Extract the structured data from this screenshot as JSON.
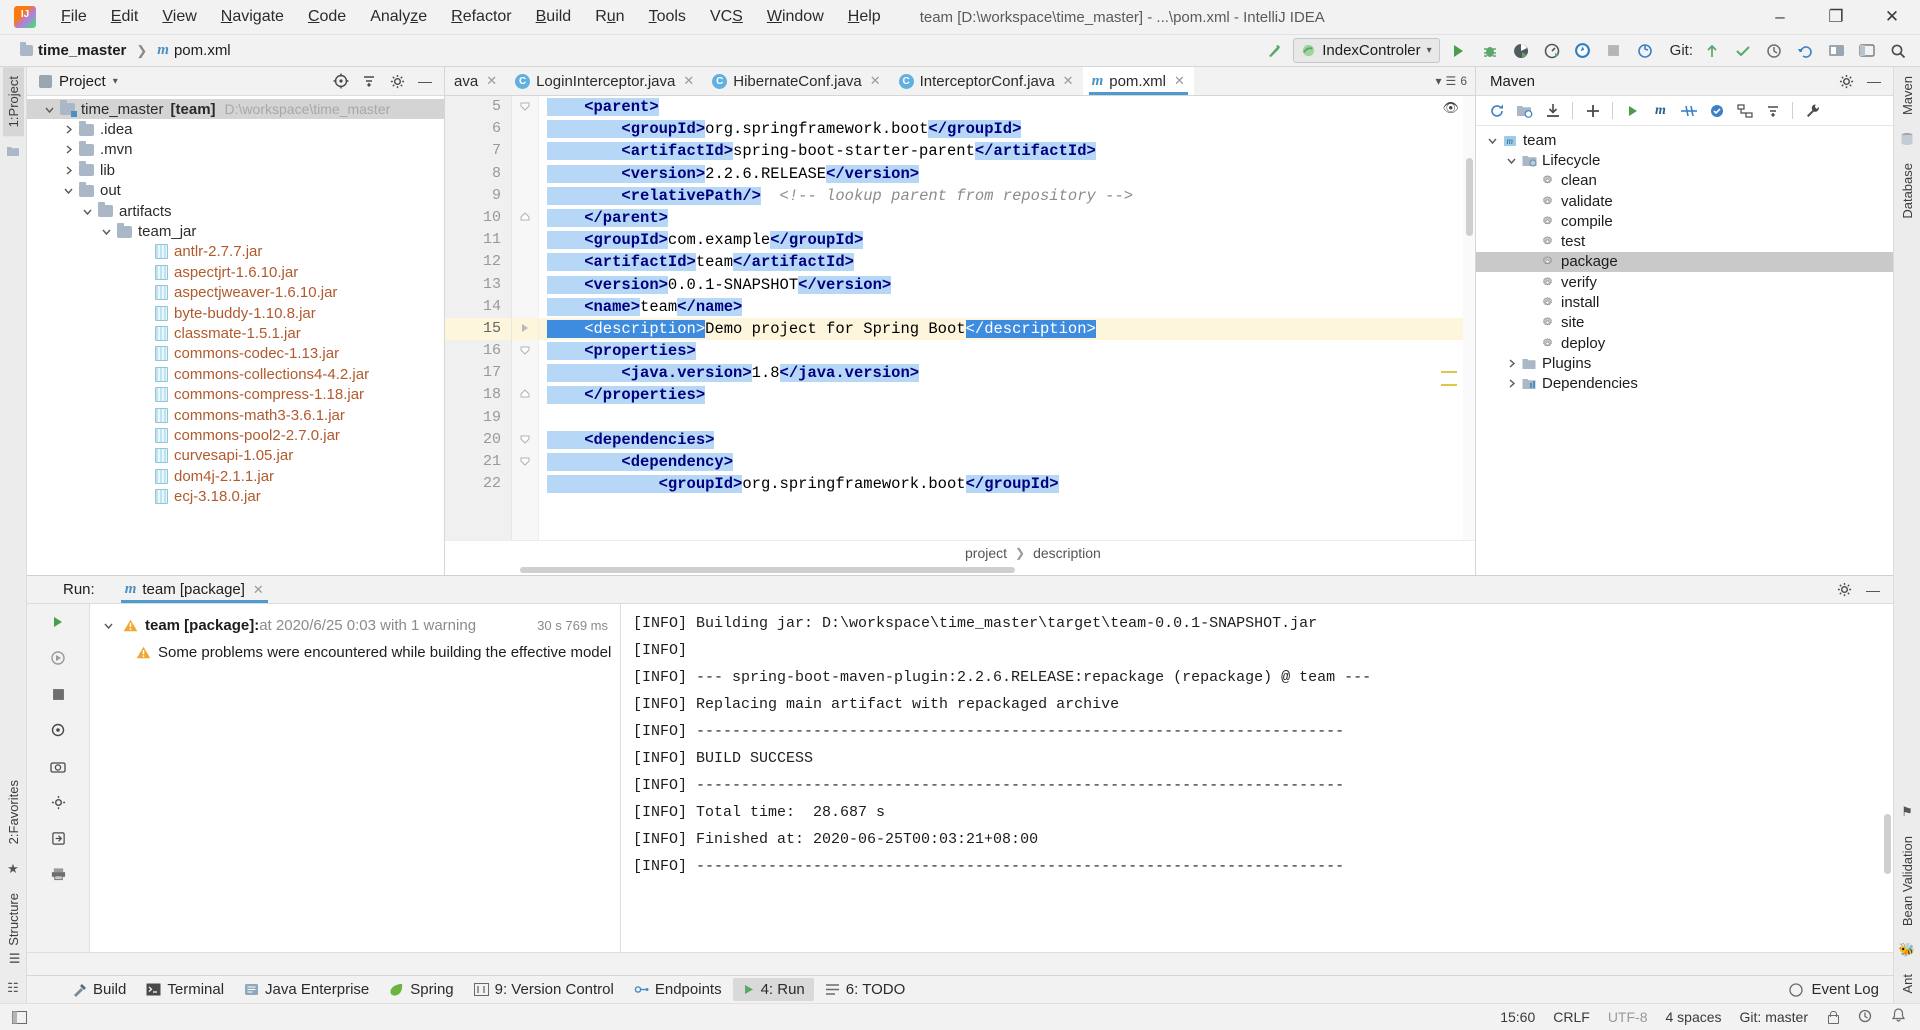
{
  "window": {
    "title": "team [D:\\workspace\\time_master] - ...\\pom.xml - IntelliJ IDEA",
    "minimize": "–",
    "maximize": "❐",
    "close": "✕"
  },
  "menu": [
    "File",
    "Edit",
    "View",
    "Navigate",
    "Code",
    "Analyze",
    "Refactor",
    "Build",
    "Run",
    "Tools",
    "VCS",
    "Window",
    "Help"
  ],
  "navbar": {
    "crumb_project": "time_master",
    "crumb_file": "pom.xml",
    "run_config": "IndexControler",
    "git_label": "Git:",
    "icons": [
      "build-icon",
      "run-icon",
      "debug-icon",
      "run-coverage-icon",
      "profiler-icon",
      "browser-icon",
      "stop-icon",
      "search-everywhere-icon"
    ]
  },
  "left_strip": {
    "tabs": [
      "Project",
      "Favorites",
      "Structure"
    ],
    "numbers": [
      "1:",
      "2:",
      ""
    ]
  },
  "right_strip": {
    "tabs": [
      "Maven",
      "Database",
      "Bean Validation",
      "Ant"
    ]
  },
  "project_panel": {
    "title": "Project",
    "tree": [
      {
        "depth": 0,
        "arrow": "down",
        "icon": "folder-module",
        "label": "time_master",
        "bracket": "[team]",
        "path": "D:\\workspace\\time_master",
        "selected": true
      },
      {
        "depth": 1,
        "arrow": "right",
        "icon": "folder",
        "label": ".idea"
      },
      {
        "depth": 1,
        "arrow": "right",
        "icon": "folder",
        "label": ".mvn"
      },
      {
        "depth": 1,
        "arrow": "right",
        "icon": "folder",
        "label": "lib"
      },
      {
        "depth": 1,
        "arrow": "down",
        "icon": "folder",
        "label": "out"
      },
      {
        "depth": 2,
        "arrow": "down",
        "icon": "folder",
        "label": "artifacts"
      },
      {
        "depth": 3,
        "arrow": "down",
        "icon": "folder",
        "label": "team_jar"
      },
      {
        "depth": 5,
        "arrow": "none",
        "icon": "jar",
        "label": "antlr-2.7.7.jar"
      },
      {
        "depth": 5,
        "arrow": "none",
        "icon": "jar",
        "label": "aspectjrt-1.6.10.jar"
      },
      {
        "depth": 5,
        "arrow": "none",
        "icon": "jar",
        "label": "aspectjweaver-1.6.10.jar"
      },
      {
        "depth": 5,
        "arrow": "none",
        "icon": "jar",
        "label": "byte-buddy-1.10.8.jar"
      },
      {
        "depth": 5,
        "arrow": "none",
        "icon": "jar",
        "label": "classmate-1.5.1.jar"
      },
      {
        "depth": 5,
        "arrow": "none",
        "icon": "jar",
        "label": "commons-codec-1.13.jar"
      },
      {
        "depth": 5,
        "arrow": "none",
        "icon": "jar",
        "label": "commons-collections4-4.2.jar"
      },
      {
        "depth": 5,
        "arrow": "none",
        "icon": "jar",
        "label": "commons-compress-1.18.jar"
      },
      {
        "depth": 5,
        "arrow": "none",
        "icon": "jar",
        "label": "commons-math3-3.6.1.jar"
      },
      {
        "depth": 5,
        "arrow": "none",
        "icon": "jar",
        "label": "commons-pool2-2.7.0.jar"
      },
      {
        "depth": 5,
        "arrow": "none",
        "icon": "jar",
        "label": "curvesapi-1.05.jar"
      },
      {
        "depth": 5,
        "arrow": "none",
        "icon": "jar",
        "label": "dom4j-2.1.1.jar"
      },
      {
        "depth": 5,
        "arrow": "none",
        "icon": "jar",
        "label": "ecj-3.18.0.jar"
      }
    ]
  },
  "editor": {
    "tabs": [
      {
        "label": "ava",
        "icon": "none",
        "active": false,
        "clipped": true
      },
      {
        "label": "LoginInterceptor.java",
        "icon": "class",
        "active": false
      },
      {
        "label": "HibernateConf.java",
        "icon": "class",
        "active": false
      },
      {
        "label": "InterceptorConf.java",
        "icon": "class",
        "active": false
      },
      {
        "label": "pom.xml",
        "icon": "maven",
        "active": true
      }
    ],
    "tab_overflow": "6",
    "lines": [
      {
        "n": "5",
        "fold": "down",
        "segs": [
          {
            "t": "tag",
            "s": "    <parent>"
          }
        ]
      },
      {
        "n": "6",
        "fold": "",
        "segs": [
          {
            "t": "tag",
            "s": "        <groupId>"
          },
          {
            "t": "txt",
            "s": "org.springframework.boot"
          },
          {
            "t": "tag",
            "s": "</groupId>"
          }
        ]
      },
      {
        "n": "7",
        "fold": "",
        "segs": [
          {
            "t": "tag",
            "s": "        <artifactId>"
          },
          {
            "t": "txt",
            "s": "spring-boot-starter-parent"
          },
          {
            "t": "tag",
            "s": "</artifactId>"
          }
        ]
      },
      {
        "n": "8",
        "fold": "",
        "segs": [
          {
            "t": "tag",
            "s": "        <version>"
          },
          {
            "t": "txt",
            "s": "2.2.6.RELEASE"
          },
          {
            "t": "tag",
            "s": "</version>"
          }
        ]
      },
      {
        "n": "9",
        "fold": "",
        "segs": [
          {
            "t": "tag",
            "s": "        <relativePath/>"
          },
          {
            "t": "cmt",
            "s": "  <!-- lookup parent from repository -->"
          }
        ]
      },
      {
        "n": "10",
        "fold": "up",
        "segs": [
          {
            "t": "tag",
            "s": "    </parent>"
          }
        ]
      },
      {
        "n": "11",
        "fold": "",
        "segs": [
          {
            "t": "tag",
            "s": "    <groupId>"
          },
          {
            "t": "txt",
            "s": "com.example"
          },
          {
            "t": "tag",
            "s": "</groupId>"
          }
        ]
      },
      {
        "n": "12",
        "fold": "",
        "segs": [
          {
            "t": "tag",
            "s": "    <artifactId>"
          },
          {
            "t": "txt",
            "s": "team"
          },
          {
            "t": "tag",
            "s": "</artifactId>"
          }
        ]
      },
      {
        "n": "13",
        "fold": "",
        "segs": [
          {
            "t": "tag",
            "s": "    <version>"
          },
          {
            "t": "txt",
            "s": "0.0.1-SNAPSHOT"
          },
          {
            "t": "tag",
            "s": "</version>"
          }
        ]
      },
      {
        "n": "14",
        "fold": "",
        "segs": [
          {
            "t": "tag",
            "s": "    <name>"
          },
          {
            "t": "txt",
            "s": "team"
          },
          {
            "t": "tag",
            "s": "</name>"
          }
        ]
      },
      {
        "n": "15",
        "fold": "",
        "highlight": true,
        "segs": [
          {
            "t": "sel",
            "s": "    <description>"
          },
          {
            "t": "txt",
            "s": "Demo project for Spring Boot"
          },
          {
            "t": "sel",
            "s": "</description>"
          }
        ]
      },
      {
        "n": "16",
        "fold": "down",
        "segs": [
          {
            "t": "tag",
            "s": "    <properties>"
          }
        ]
      },
      {
        "n": "17",
        "fold": "",
        "segs": [
          {
            "t": "tag",
            "s": "        <java.version>"
          },
          {
            "t": "txt",
            "s": "1.8"
          },
          {
            "t": "tag",
            "s": "</java.version>"
          }
        ]
      },
      {
        "n": "18",
        "fold": "up",
        "segs": [
          {
            "t": "tag",
            "s": "    </properties>"
          }
        ]
      },
      {
        "n": "19",
        "fold": "",
        "segs": [
          {
            "t": "txt",
            "s": ""
          }
        ]
      },
      {
        "n": "20",
        "fold": "down",
        "segs": [
          {
            "t": "tag",
            "s": "    <dependencies>"
          }
        ]
      },
      {
        "n": "21",
        "fold": "down",
        "segs": [
          {
            "t": "tag",
            "s": "        <dependency>"
          }
        ]
      },
      {
        "n": "22",
        "fold": "",
        "segs": [
          {
            "t": "tag",
            "s": "            <groupId>"
          },
          {
            "t": "txt",
            "s": "org.springframework.boot"
          },
          {
            "t": "tag",
            "s": "</groupId>"
          }
        ]
      }
    ],
    "breadcrumb": [
      "project",
      "description"
    ]
  },
  "maven_panel": {
    "title": "Maven",
    "toolbar_icons": [
      "reimport-icon",
      "generate-sources-icon",
      "download-sources-icon",
      "add-icon",
      "run-icon",
      "maven-m-icon",
      "skip-tests-icon",
      "toggle-offline-icon",
      "show-diagram-icon",
      "collapse-all-icon",
      "settings-icon"
    ],
    "tree": [
      {
        "depth": 0,
        "arrow": "down",
        "icon": "maven-project",
        "label": "team"
      },
      {
        "depth": 1,
        "arrow": "down",
        "icon": "lifecycle",
        "label": "Lifecycle"
      },
      {
        "depth": 2,
        "arrow": "none",
        "icon": "gear",
        "label": "clean"
      },
      {
        "depth": 2,
        "arrow": "none",
        "icon": "gear",
        "label": "validate"
      },
      {
        "depth": 2,
        "arrow": "none",
        "icon": "gear",
        "label": "compile"
      },
      {
        "depth": 2,
        "arrow": "none",
        "icon": "gear",
        "label": "test"
      },
      {
        "depth": 2,
        "arrow": "none",
        "icon": "gear",
        "label": "package",
        "selected": true
      },
      {
        "depth": 2,
        "arrow": "none",
        "icon": "gear",
        "label": "verify"
      },
      {
        "depth": 2,
        "arrow": "none",
        "icon": "gear",
        "label": "install"
      },
      {
        "depth": 2,
        "arrow": "none",
        "icon": "gear",
        "label": "site"
      },
      {
        "depth": 2,
        "arrow": "none",
        "icon": "gear",
        "label": "deploy"
      },
      {
        "depth": 1,
        "arrow": "right",
        "icon": "plugins",
        "label": "Plugins"
      },
      {
        "depth": 1,
        "arrow": "right",
        "icon": "dependencies",
        "label": "Dependencies"
      }
    ]
  },
  "run_panel": {
    "label": "Run:",
    "tab": "team [package]",
    "tree": [
      {
        "bold": "team [package]:",
        "text": " at 2020/6/25 0:03 with 1 warning",
        "duration": "30 s 769 ms",
        "indent": 0,
        "warn": true,
        "arrow": true
      },
      {
        "bold": "",
        "text": "Some problems were encountered while building the effective model",
        "duration": "",
        "indent": 1,
        "warn": true,
        "arrow": false
      }
    ],
    "console": [
      "[INFO] Building jar: D:\\workspace\\time_master\\target\\team-0.0.1-SNAPSHOT.jar",
      "[INFO]",
      "[INFO] --- spring-boot-maven-plugin:2.2.6.RELEASE:repackage (repackage) @ team ---",
      "[INFO] Replacing main artifact with repackaged archive",
      "[INFO] ------------------------------------------------------------------------",
      "[INFO] BUILD SUCCESS",
      "[INFO] ------------------------------------------------------------------------",
      "[INFO] Total time:  28.687 s",
      "[INFO] Finished at: 2020-06-25T00:03:21+08:00",
      "[INFO] ------------------------------------------------------------------------"
    ]
  },
  "bottom_bar": {
    "tabs": [
      {
        "label": "Build",
        "icon": "hammer-icon",
        "active": false
      },
      {
        "label": "Terminal",
        "icon": "terminal-icon",
        "active": false
      },
      {
        "label": "Java Enterprise",
        "icon": "java-ee-icon",
        "active": false
      },
      {
        "label": "Spring",
        "icon": "spring-leaf-icon",
        "active": false
      },
      {
        "label": "9: Version Control",
        "icon": "vcs-icon",
        "active": false
      },
      {
        "label": "Endpoints",
        "icon": "endpoints-icon",
        "active": false
      },
      {
        "label": "4: Run",
        "icon": "run-icon",
        "active": true
      },
      {
        "label": "6: TODO",
        "icon": "todo-icon",
        "active": false
      }
    ],
    "event_log": "Event Log"
  },
  "statusbar": {
    "caret": "15:60",
    "line_sep": "CRLF",
    "encoding": "UTF-8",
    "indent": "4 spaces",
    "branch": "Git: master"
  }
}
